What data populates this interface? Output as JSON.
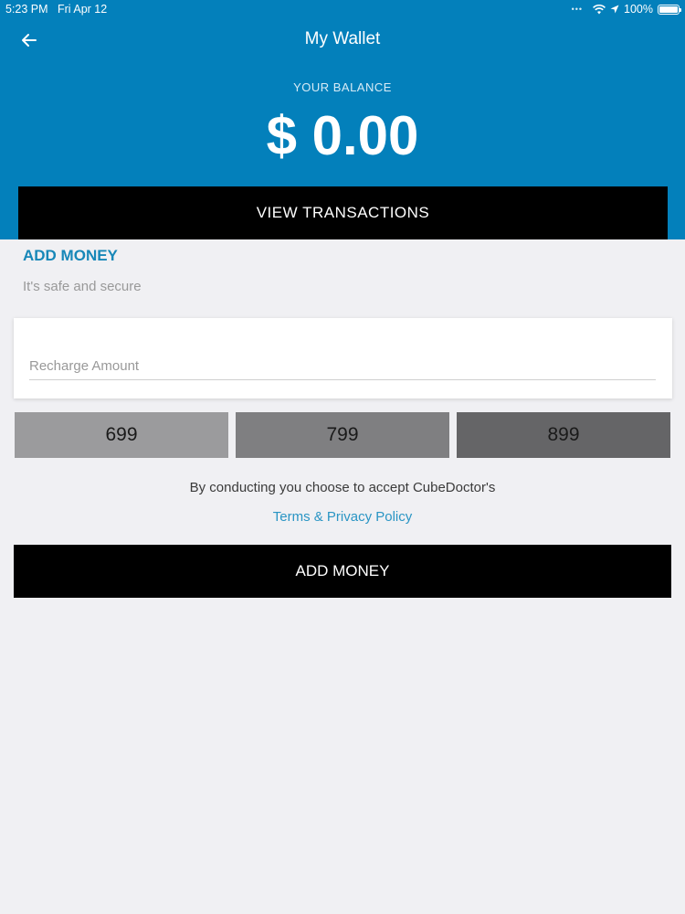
{
  "status_bar": {
    "time": "5:23 PM",
    "date": "Fri Apr 12",
    "battery": "100%"
  },
  "header": {
    "title": "My Wallet",
    "balance_label": "YOUR BALANCE",
    "balance_value": "$ 0.00",
    "view_transactions_label": "VIEW TRANSACTIONS",
    "background_color": "#0380bb"
  },
  "add_money": {
    "section_title": "ADD MONEY",
    "subtitle": "It's safe and secure",
    "amount_placeholder": "Recharge Amount",
    "amount_value": "",
    "presets": [
      "699",
      "799",
      "899"
    ],
    "consent_text": "By conducting you choose to accept CubeDoctor's",
    "terms_link": "Terms & Privacy Policy",
    "submit_label": "ADD MONEY"
  },
  "colors": {
    "accent": "#1787b8",
    "link": "#2a95c4",
    "button": "#000000"
  }
}
